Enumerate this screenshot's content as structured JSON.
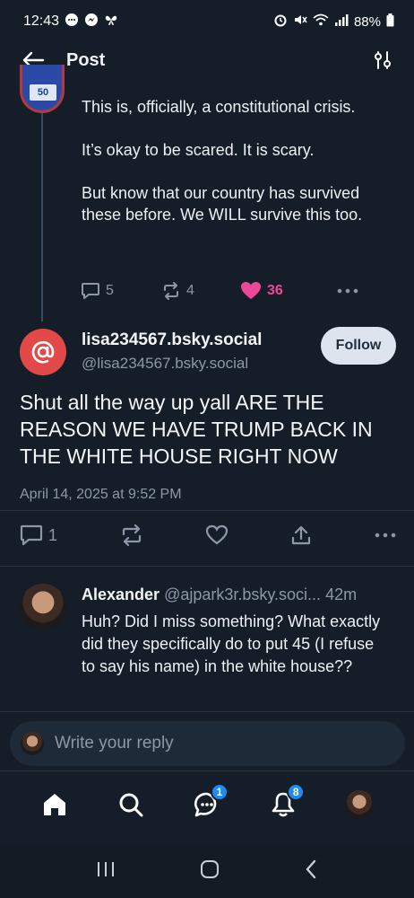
{
  "status_bar": {
    "time": "12:43",
    "battery": "88%"
  },
  "header": {
    "title": "Post"
  },
  "parent_post": {
    "avatar_badge": "50",
    "paragraphs": [
      "This is, officially, a constitutional crisis.",
      "It’s okay to be scared. It is scary.",
      "But know that our country has survived these before. We WILL survive this too."
    ],
    "reply_count": "5",
    "repost_count": "4",
    "like_count": "36"
  },
  "main_post": {
    "author_display": "lisa234567.bsky.social",
    "author_handle": "@lisa234567.bsky.social",
    "follow_label": "Follow",
    "body": "Shut all the way up yall ARE THE REASON WE HAVE TRUMP BACK IN THE WHITE HOUSE RIGHT  NOW",
    "date": "April 14, 2025 at 9:52 PM",
    "reply_count": "1"
  },
  "reply": {
    "name": "Alexander",
    "handle": "@ajpark3r.bsky.soci...",
    "time": "42m",
    "text": "Huh? Did I miss something? What exactly did they specifically do to put 45 (I refuse to say his name) in the white house??"
  },
  "composer": {
    "placeholder": "Write your reply"
  },
  "tab_bar": {
    "chat_badge": "1",
    "notifications_badge": "8"
  },
  "colors": {
    "background": "#151d28",
    "accent_blue": "#1d8cf0",
    "like_pink": "#ec4899",
    "avatar_red": "#e24a4a"
  }
}
